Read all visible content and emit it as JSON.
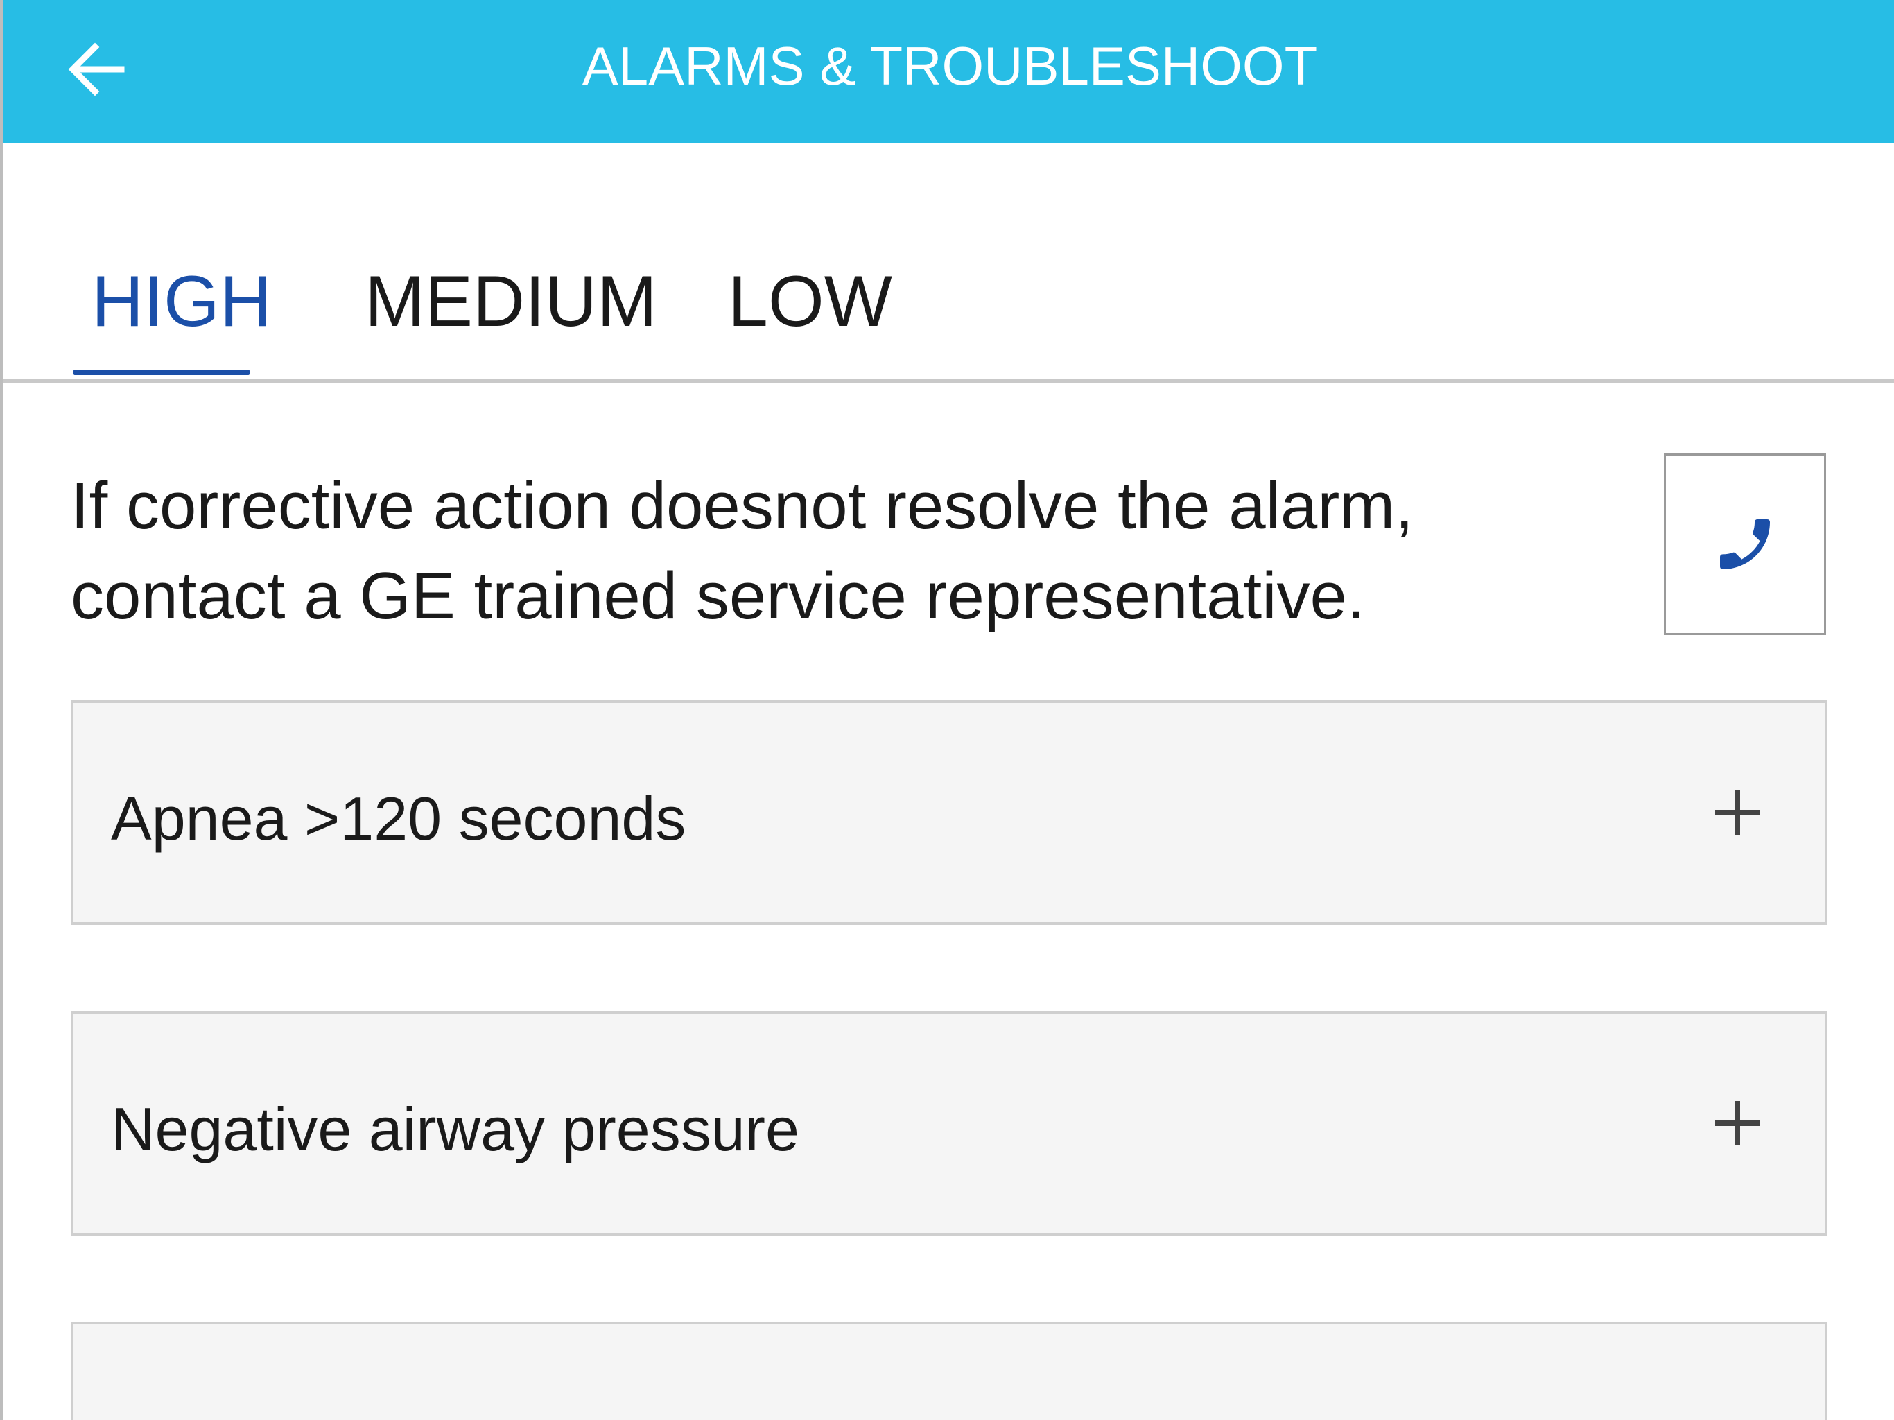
{
  "header": {
    "title": "ALARMS & TROUBLESHOOT",
    "back_icon": "arrow-left-icon",
    "background_color": "#27bde5"
  },
  "tabs": [
    {
      "label": "HIGH",
      "active": true
    },
    {
      "label": "MEDIUM",
      "active": false
    },
    {
      "label": "LOW",
      "active": false
    }
  ],
  "accent_color": "#1b4fa8",
  "info": {
    "text": "If corrective action doesnot resolve the alarm, contact a GE trained service representative.",
    "call_icon": "phone-icon"
  },
  "alarms": [
    {
      "label": "Apnea >120 seconds",
      "icon": "plus-icon"
    },
    {
      "label": "Negative airway pressure",
      "icon": "plus-icon"
    },
    {
      "label": "",
      "icon": ""
    }
  ]
}
